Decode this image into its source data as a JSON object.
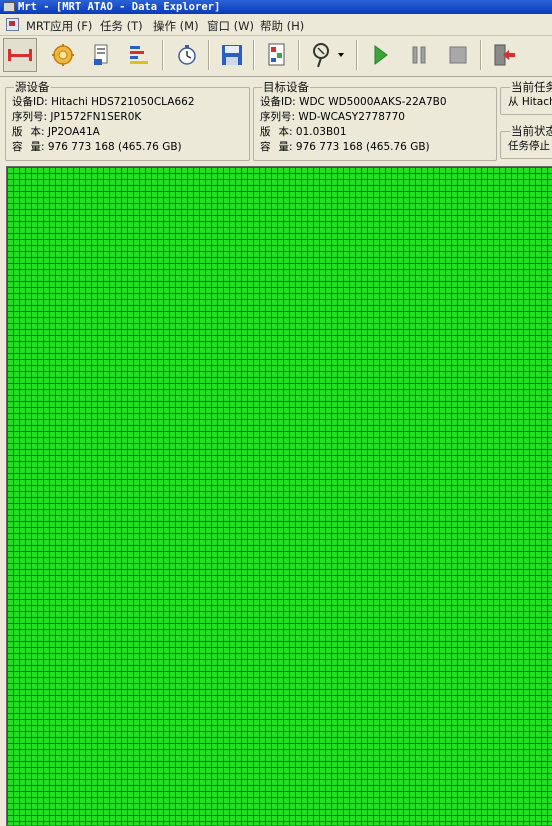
{
  "window": {
    "title": "Mrt - [MRT ATAO - Data Explorer]"
  },
  "menu": {
    "items": [
      {
        "label": "MRT应用 (F)"
      },
      {
        "label": "任务 (T)"
      },
      {
        "label": "操作 (M)"
      },
      {
        "label": "窗口 (W)"
      },
      {
        "label": "帮助 (H)"
      }
    ]
  },
  "toolbar": {
    "buttons": [
      {
        "icon": "connect-drives-icon"
      },
      {
        "icon": "settings-gear-icon"
      },
      {
        "icon": "drive-info-icon"
      },
      {
        "icon": "sector-map-icon"
      },
      {
        "icon": "timer-icon"
      },
      {
        "icon": "save-icon"
      },
      {
        "icon": "report-icon"
      },
      {
        "icon": "key-tool-icon"
      },
      {
        "icon": "play-icon"
      },
      {
        "icon": "pause-icon"
      },
      {
        "icon": "stop-icon"
      },
      {
        "icon": "exit-icon"
      }
    ],
    "colors": {
      "play": "#3aa63a",
      "red": "#d83030",
      "blue": "#2a5fc4"
    }
  },
  "source": {
    "legend": "源设备",
    "device_id_label": "设备ID:",
    "device_id": "Hitachi HDS721050CLA662",
    "serial_label": "序列号:",
    "serial": "JP1572FN1SER0K",
    "version_label": "版",
    "version_label2": "本:",
    "version": "JP2OA41A",
    "capacity_label": "容",
    "capacity_label2": "量:",
    "capacity": "976 773 168 (465.76 GB)"
  },
  "target": {
    "legend": "目标设备",
    "device_id_label": "设备ID:",
    "device_id": "WDC WD5000AAKS-22A7B0",
    "serial_label": "序列号:",
    "serial": "WD-WCASY2778770",
    "version_label": "版",
    "version_label2": "本:",
    "version": "01.03B01",
    "capacity_label": "容",
    "capacity_label2": "量:",
    "capacity": "976 773 168 (465.76 GB)"
  },
  "task": {
    "current_task_legend": "当前任务",
    "current_task_text": "从 Hitach",
    "current_status_legend": "当前状态",
    "current_status_text": "任务停止"
  },
  "sector_map": {
    "state": "all sectors copied",
    "cell_color": "#24e024",
    "grid_color": "#2e5a2e"
  }
}
